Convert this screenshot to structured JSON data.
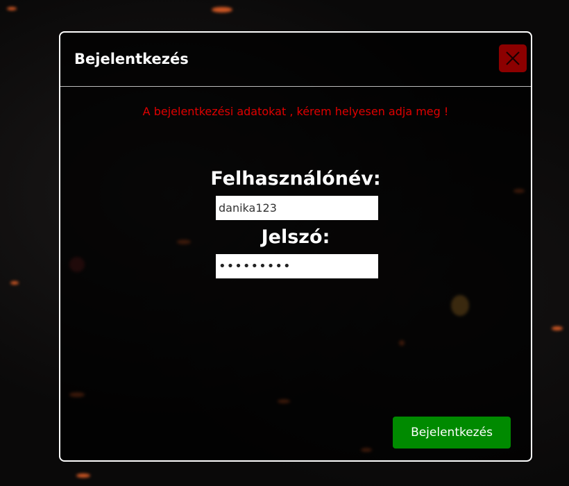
{
  "dialog": {
    "title": "Bejelentkezés",
    "close_icon": "close-icon",
    "error_message": "A bejelentkezési adatokat , kérem helyesen adja meg !"
  },
  "form": {
    "username_label": "Felhasználónév:",
    "username_value": "danika123",
    "password_label": "Jelszó:",
    "password_value": "•••••••••"
  },
  "actions": {
    "login_label": "Bejelentkezés"
  },
  "colors": {
    "close_bg": "#8c0000",
    "error_text": "#e00000",
    "login_bg": "#008a00"
  }
}
